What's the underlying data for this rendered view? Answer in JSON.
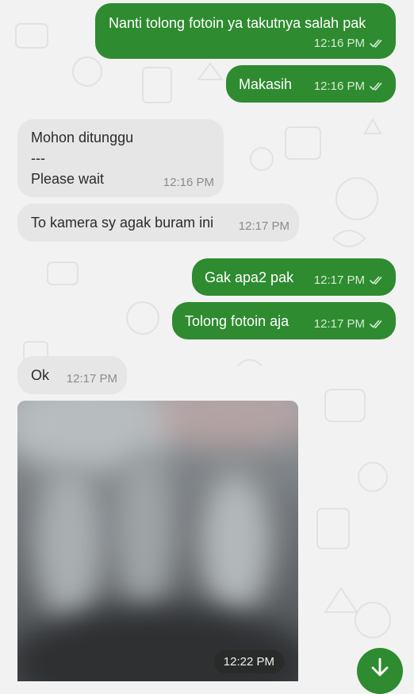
{
  "messages": [
    {
      "text": "Nanti tolong fotoin ya takutnya salah pak",
      "time": "12:16 PM"
    },
    {
      "text": "Makasih",
      "time": "12:16 PM"
    },
    {
      "text": "Mohon ditunggu\n---\nPlease wait",
      "time": "12:16 PM"
    },
    {
      "text": "To kamera sy agak buram ini",
      "time": "12:17 PM"
    },
    {
      "text": "Gak apa2 pak",
      "time": "12:17 PM"
    },
    {
      "text": "Tolong fotoin aja",
      "time": "12:17 PM"
    },
    {
      "text": "Ok",
      "time": "12:17 PM"
    },
    {
      "time": "12:22 PM"
    }
  ],
  "icons": {
    "read_receipt": "double-check-icon",
    "scroll_down": "arrow-down-icon"
  },
  "colors": {
    "outgoing_bubble": "#2e8b30",
    "incoming_bubble": "#e6e6e6",
    "background": "#f2f2f2",
    "fab": "#2e8b30"
  }
}
